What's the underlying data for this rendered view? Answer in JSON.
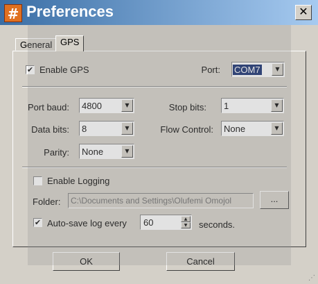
{
  "window": {
    "title": "Preferences",
    "title_icon": "#",
    "close_label": "✕"
  },
  "tabs": [
    {
      "label": "General",
      "active": false
    },
    {
      "label": "GPS",
      "active": true
    }
  ],
  "gps": {
    "enable_gps": {
      "label": "Enable GPS",
      "checked": true
    },
    "port": {
      "label": "Port:",
      "value": "COM7"
    },
    "port_baud": {
      "label": "Port baud:",
      "value": "4800"
    },
    "stop_bits": {
      "label": "Stop bits:",
      "value": "1"
    },
    "data_bits": {
      "label": "Data bits:",
      "value": "8"
    },
    "flow_control": {
      "label": "Flow Control:",
      "value": "None"
    },
    "parity": {
      "label": "Parity:",
      "value": "None"
    }
  },
  "logging": {
    "enable_logging": {
      "label": "Enable Logging",
      "checked": false
    },
    "folder": {
      "label": "Folder:",
      "value": "C:\\Documents and Settings\\Olufemi Omojol"
    },
    "browse_label": "...",
    "autosave": {
      "label": "Auto-save log every",
      "checked": true,
      "value": "60",
      "unit": "seconds."
    }
  },
  "buttons": {
    "ok": "OK",
    "cancel": "Cancel"
  },
  "icons": {
    "check": "✔",
    "arrow": "▼",
    "up": "▲",
    "down": "▼",
    "grip": "⋰"
  },
  "colors": {
    "title_start": "#3a6ea5",
    "title_end": "#a6caf0",
    "selection": "#0a246a",
    "face": "#d4d0c8"
  }
}
